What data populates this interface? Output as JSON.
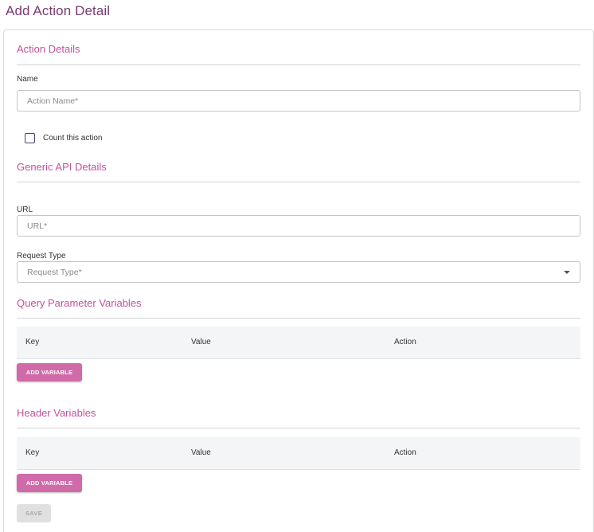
{
  "page": {
    "title": "Add Action Detail"
  },
  "action_details": {
    "title": "Action Details",
    "name_label": "Name",
    "name_placeholder": "Action Name*",
    "count_checkbox_label": "Count this action",
    "count_checked": false
  },
  "generic_api": {
    "title": "Generic API Details",
    "url_label": "URL",
    "url_placeholder": "URL*",
    "request_type_label": "Request Type",
    "request_type_placeholder": "Request Type*"
  },
  "query_params": {
    "title": "Query Parameter Variables",
    "columns": [
      "Key",
      "Value",
      "Action"
    ],
    "add_button": "ADD VARIABLE"
  },
  "headers": {
    "title": "Header Variables",
    "columns": [
      "Key",
      "Value",
      "Action"
    ],
    "add_button": "ADD VARIABLE"
  },
  "save_button": "SAVE",
  "colors": {
    "title": "#7a3a73",
    "section_title": "#c64f9c",
    "button": "#d06aa9",
    "table_header_bg": "#f4f5f7"
  }
}
